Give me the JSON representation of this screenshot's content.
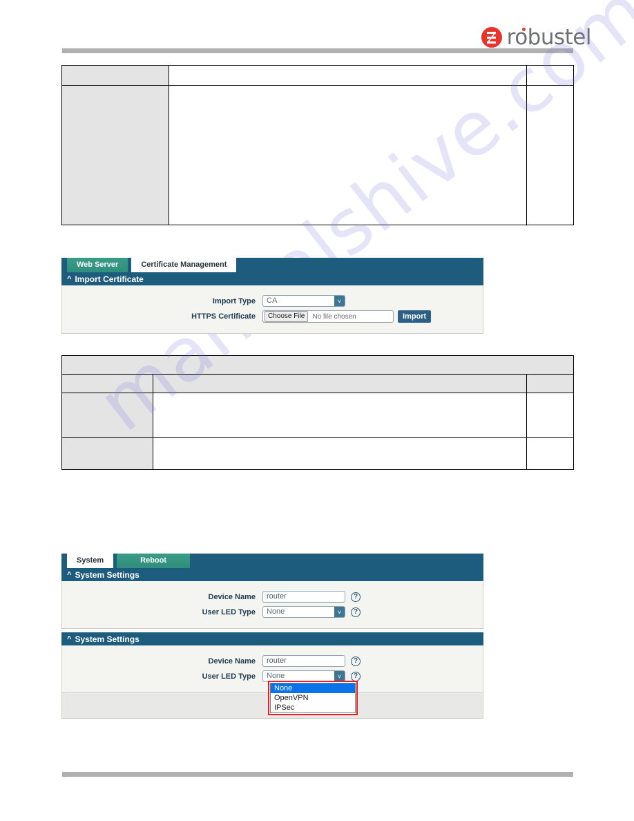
{
  "brand": {
    "logo_text": "robustel",
    "logo_icon": "robustel-logo-icon"
  },
  "watermark": {
    "text": "manualshive.com"
  },
  "tables": {
    "table_one": {
      "rows": [
        {
          "label": "",
          "description": "",
          "value": ""
        },
        {
          "label": "",
          "description": "",
          "value": ""
        }
      ]
    },
    "table_two": {
      "caption": "",
      "header": {
        "label": "",
        "description": "",
        "value": ""
      },
      "rows": [
        {
          "label": "",
          "description": "",
          "value": ""
        },
        {
          "label": "",
          "description": "",
          "value": ""
        }
      ]
    }
  },
  "certificate_panel": {
    "tabs": [
      {
        "label": "Web Server",
        "active": false
      },
      {
        "label": "Certificate Management",
        "active": true
      }
    ],
    "section_title": "Import Certificate",
    "collapse_icon": "chevron-up-icon",
    "fields": {
      "import_type": {
        "label": "Import Type",
        "value": "CA",
        "arrow_icon": "chevron-down-icon"
      },
      "https_certificate": {
        "label": "HTTPS Certificate",
        "choose_button": "Choose File",
        "file_status": "No file chosen",
        "import_button": "Import"
      }
    }
  },
  "system_panel_one": {
    "tabs": [
      {
        "label": "System",
        "active": true
      },
      {
        "label": "Reboot",
        "active": false
      }
    ],
    "section_title": "System Settings",
    "collapse_icon": "chevron-up-icon",
    "fields": {
      "device_name": {
        "label": "Device Name",
        "value": "router",
        "help_icon": "question-mark-icon"
      },
      "user_led_type": {
        "label": "User LED Type",
        "value": "None",
        "arrow_icon": "chevron-down-icon",
        "help_icon": "question-mark-icon"
      }
    }
  },
  "system_panel_two": {
    "section_title": "System Settings",
    "collapse_icon": "chevron-up-icon",
    "fields": {
      "device_name": {
        "label": "Device Name",
        "value": "router",
        "help_icon": "question-mark-icon"
      },
      "user_led_type": {
        "label": "User LED Type",
        "value": "None",
        "arrow_icon": "chevron-down-icon",
        "help_icon": "question-mark-icon"
      }
    },
    "dropdown": {
      "highlight_color": "#0a73e8",
      "outline_color": "#ec1c24",
      "options": [
        {
          "label": "None",
          "selected": true
        },
        {
          "label": "OpenVPN",
          "selected": false
        },
        {
          "label": "IPSec",
          "selected": false
        }
      ]
    }
  },
  "colors": {
    "panel_header": "#1d5c7d",
    "tab_inactive": "#2f8e7c",
    "rule_gray": "#b0b0b0",
    "brand_red": "#e8352b"
  }
}
